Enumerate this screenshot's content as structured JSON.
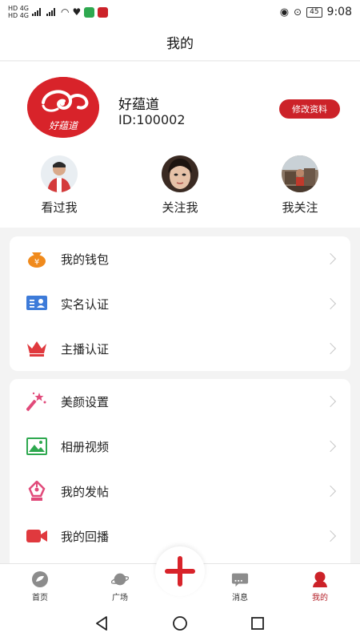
{
  "status_bar": {
    "network_1": "HD 4G",
    "network_2": "HD 4G",
    "battery": "45",
    "time": "9:08"
  },
  "header": {
    "title": "我的"
  },
  "profile": {
    "logo_text": "好蕴道",
    "name": "好蕴道",
    "id_text": "ID:100002",
    "edit_label": "修改资料"
  },
  "follow": [
    {
      "label": "看过我"
    },
    {
      "label": "关注我"
    },
    {
      "label": "我关注"
    }
  ],
  "menu_group_1": [
    {
      "label": "我的钱包",
      "icon": "wallet-icon",
      "color": "#f08a1c"
    },
    {
      "label": "实名认证",
      "icon": "id-card-icon",
      "color": "#3d7bd9"
    },
    {
      "label": "主播认证",
      "icon": "crown-icon",
      "color": "#e0393e"
    }
  ],
  "menu_group_2": [
    {
      "label": "美颜设置",
      "icon": "magic-wand-icon",
      "color": "#e14a7a"
    },
    {
      "label": "相册视频",
      "icon": "image-icon",
      "color": "#2ea84f"
    },
    {
      "label": "我的发帖",
      "icon": "pen-nib-icon",
      "color": "#e14a7a"
    },
    {
      "label": "我的回播",
      "icon": "video-camera-icon",
      "color": "#e0393e"
    }
  ],
  "bottom_nav": [
    {
      "label": "首页",
      "icon": "home-icon",
      "active": false
    },
    {
      "label": "广场",
      "icon": "planet-icon",
      "active": false
    },
    {
      "label": "消息",
      "icon": "message-icon",
      "active": false
    },
    {
      "label": "我的",
      "icon": "profile-icon",
      "active": true
    }
  ],
  "colors": {
    "accent": "#cc2229",
    "inactive_icon": "#8c8c8c"
  }
}
